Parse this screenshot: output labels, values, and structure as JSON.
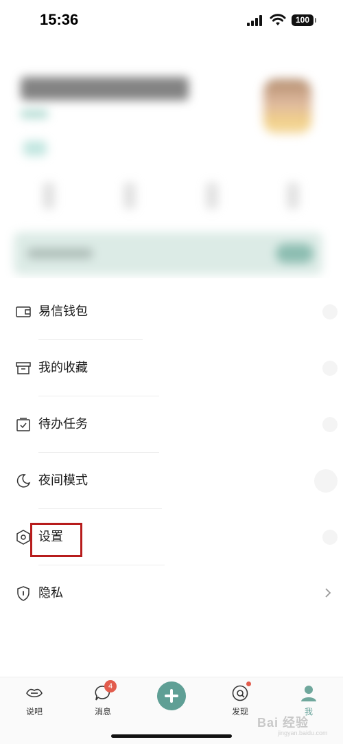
{
  "status_bar": {
    "time": "15:36",
    "battery": "100"
  },
  "menu": {
    "items": [
      {
        "label": "易信钱包",
        "icon": "wallet-icon"
      },
      {
        "label": "我的收藏",
        "icon": "archive-box-icon"
      },
      {
        "label": "待办任务",
        "icon": "checklist-icon"
      },
      {
        "label": "夜间模式",
        "icon": "moon-icon"
      },
      {
        "label": "设置",
        "icon": "gear-hexagon-icon"
      },
      {
        "label": "隐私",
        "icon": "shield-icon"
      }
    ]
  },
  "tab_bar": {
    "tabs": [
      {
        "label": "说吧",
        "icon": "lips-icon"
      },
      {
        "label": "消息",
        "icon": "chat-bubble-icon",
        "badge": "4"
      },
      {
        "label": "",
        "icon": "plus-icon"
      },
      {
        "label": "发现",
        "icon": "compass-icon"
      },
      {
        "label": "我",
        "icon": "person-icon"
      }
    ],
    "accent_color": "#5f9f95",
    "badge_color": "#e25c4d"
  },
  "watermark": {
    "text": "Bai 经验",
    "sub": "jingyan.baidu.com"
  }
}
